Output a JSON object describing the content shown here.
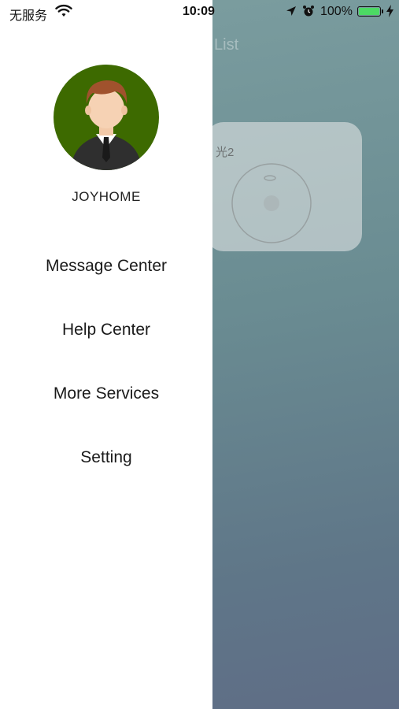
{
  "status_bar": {
    "carrier": "无服务",
    "time": "10:09",
    "battery_percent": "100%",
    "icons": [
      "wifi-icon",
      "location-arrow-icon",
      "alarm-clock-icon",
      "battery-icon",
      "charging-bolt-icon"
    ]
  },
  "background": {
    "title_fragment": "List",
    "device_name": "光2"
  },
  "drawer": {
    "username": "JOYHOME",
    "avatar_icon": "user-avatar-icon",
    "menu": [
      {
        "label": "Message Center"
      },
      {
        "label": "Help Center"
      },
      {
        "label": "More Services"
      },
      {
        "label": "Setting"
      }
    ]
  },
  "colors": {
    "drawer_bg": "#ffffff",
    "avatar_bg": "#3d6a00",
    "battery_fill": "#4cd964"
  }
}
